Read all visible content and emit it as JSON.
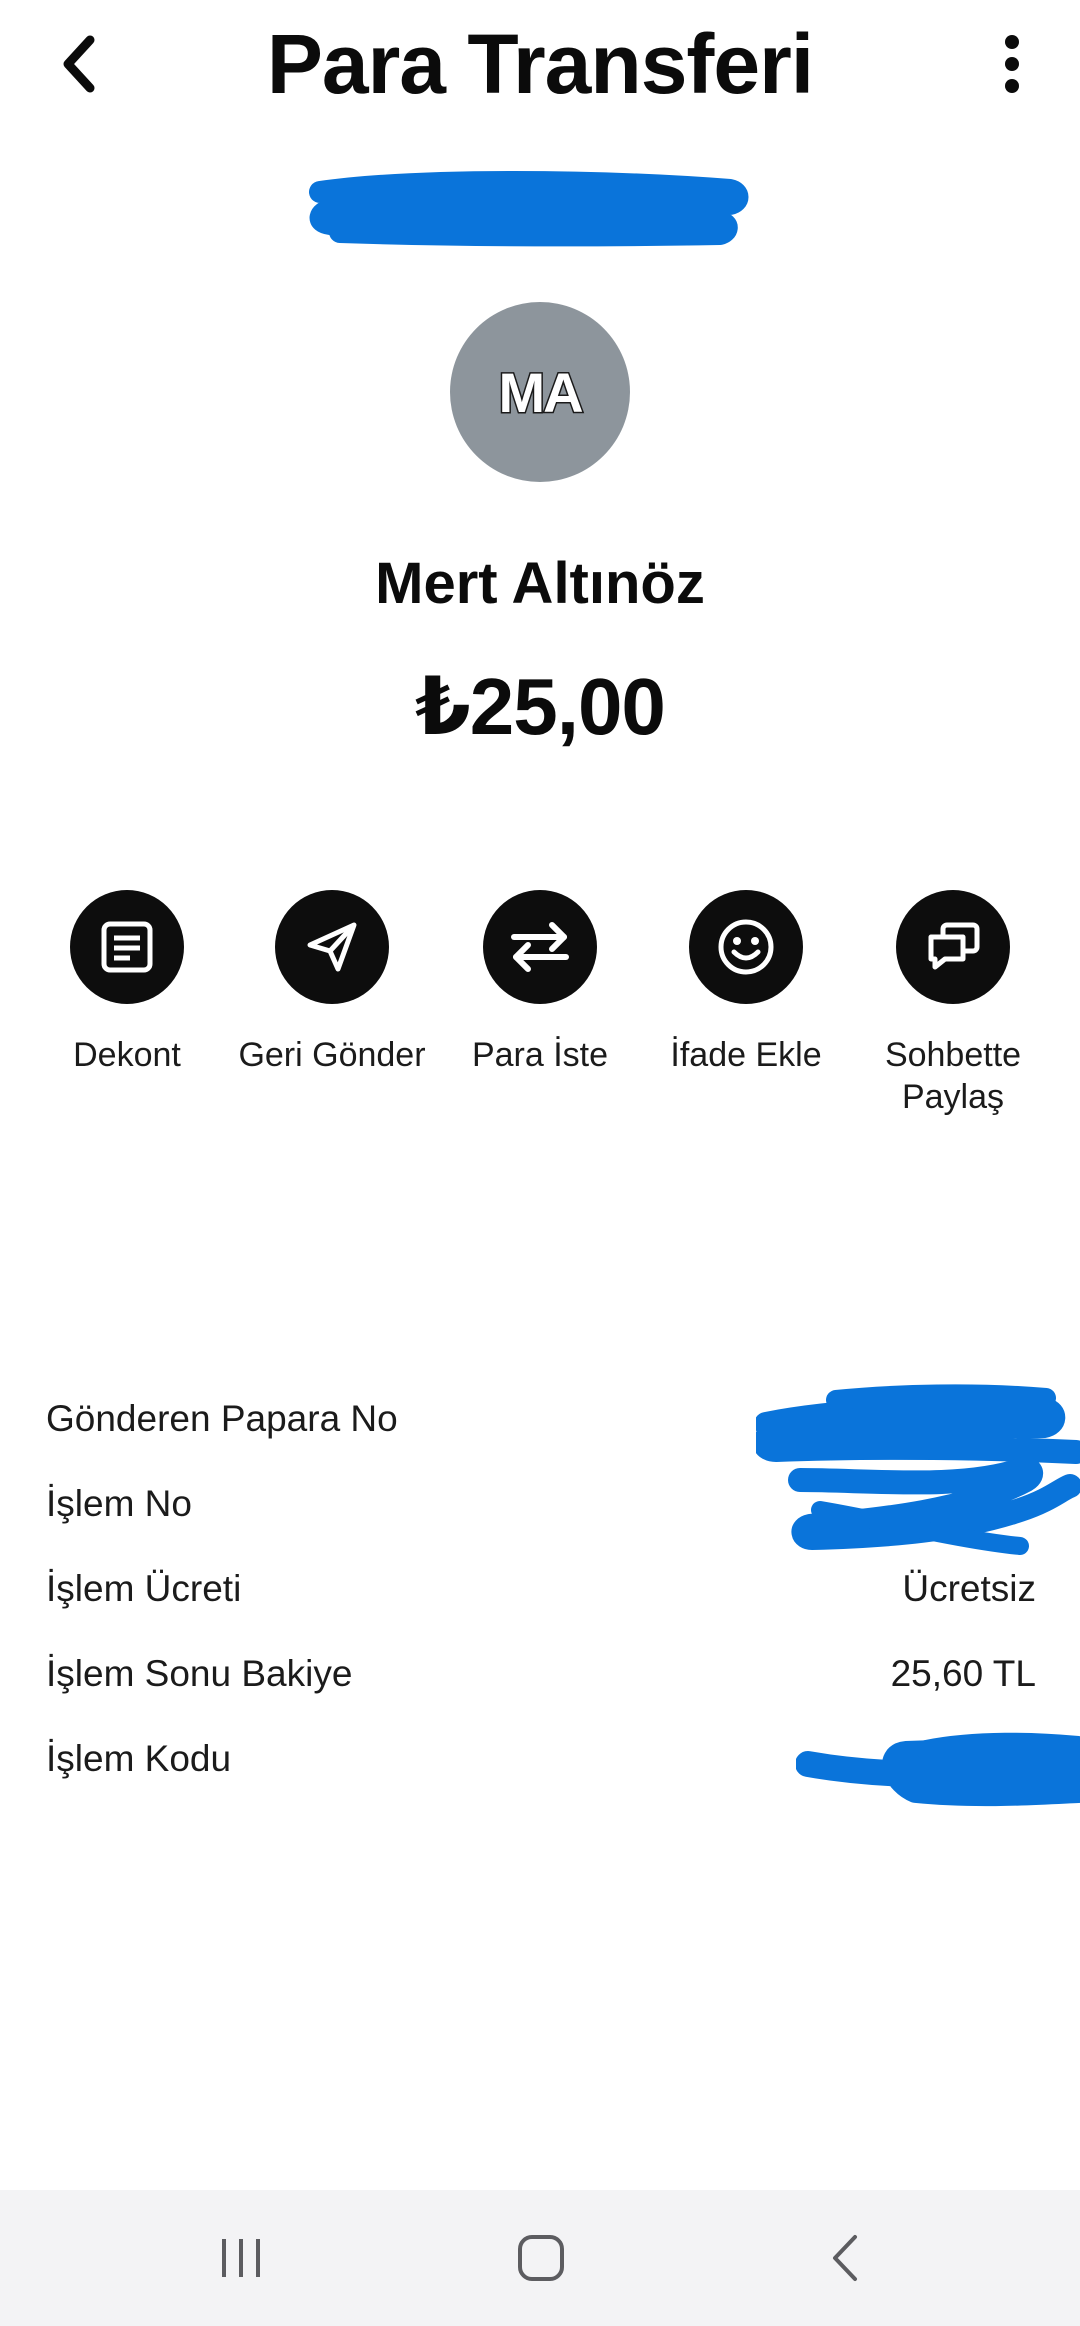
{
  "header": {
    "title": "Para Transferi",
    "back_icon": "chevron-left-icon",
    "menu_icon": "more-vertical-icon"
  },
  "recipient": {
    "avatar_initials": "MA",
    "name": "Mert Altınöz",
    "amount": "₺25,00",
    "avatar_color": "#8d959c"
  },
  "actions": [
    {
      "label": "Dekont",
      "icon": "receipt-icon"
    },
    {
      "label": "Geri Gönder",
      "icon": "send-icon"
    },
    {
      "label": "Para İste",
      "icon": "swap-arrows-icon"
    },
    {
      "label": "İfade Ekle",
      "icon": "smiley-icon"
    },
    {
      "label": "Sohbette Paylaş",
      "icon": "chat-bubbles-icon"
    }
  ],
  "details": [
    {
      "label": "Gönderen Papara No",
      "value": ""
    },
    {
      "label": "İşlem No",
      "value": ""
    },
    {
      "label": "İşlem Ücreti",
      "value": "Ücretsiz"
    },
    {
      "label": "İşlem Sonu Bakiye",
      "value": "25,60 TL"
    },
    {
      "label": "İşlem Kodu",
      "value": ""
    }
  ],
  "colors": {
    "redaction": "#0a74da",
    "action_circle": "#0d0d0d",
    "navbar_bg": "#f3f3f5"
  },
  "navbar": {
    "recents_icon": "recents-icon",
    "home_icon": "home-icon",
    "back_icon": "back-icon"
  }
}
